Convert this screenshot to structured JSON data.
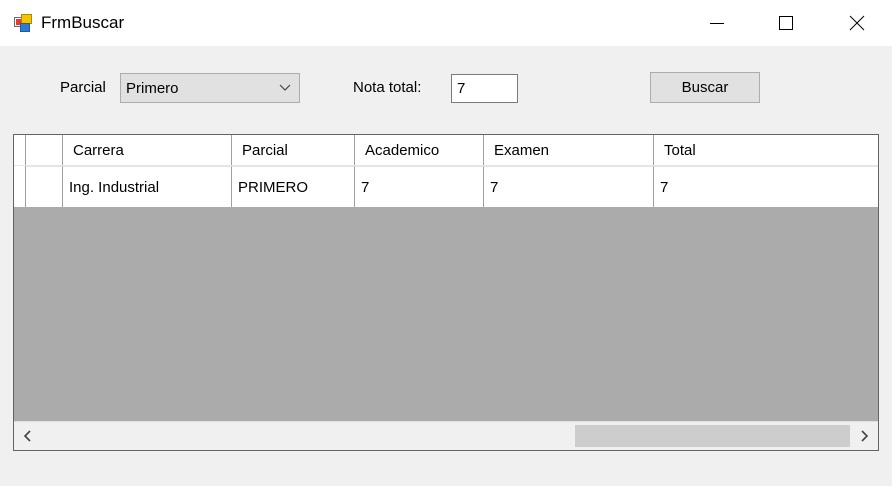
{
  "window": {
    "title": "FrmBuscar",
    "icon": "winforms-app-icon",
    "controls": [
      "minimize-icon",
      "maximize-icon",
      "close-icon"
    ]
  },
  "filters": {
    "parcial_label": "Parcial",
    "parcial_value": "Primero",
    "nota_label": "Nota total:",
    "nota_value": "7",
    "buscar_label": "Buscar"
  },
  "grid": {
    "columns": [
      "Carrera",
      "Parcial",
      "Academico",
      "Examen",
      "Total"
    ],
    "rows": [
      [
        "Ing. Industrial",
        "PRIMERO",
        "7",
        "7",
        "7"
      ]
    ],
    "hscroll": {
      "thumb_start": 0.66,
      "thumb_size": 0.34
    }
  }
}
